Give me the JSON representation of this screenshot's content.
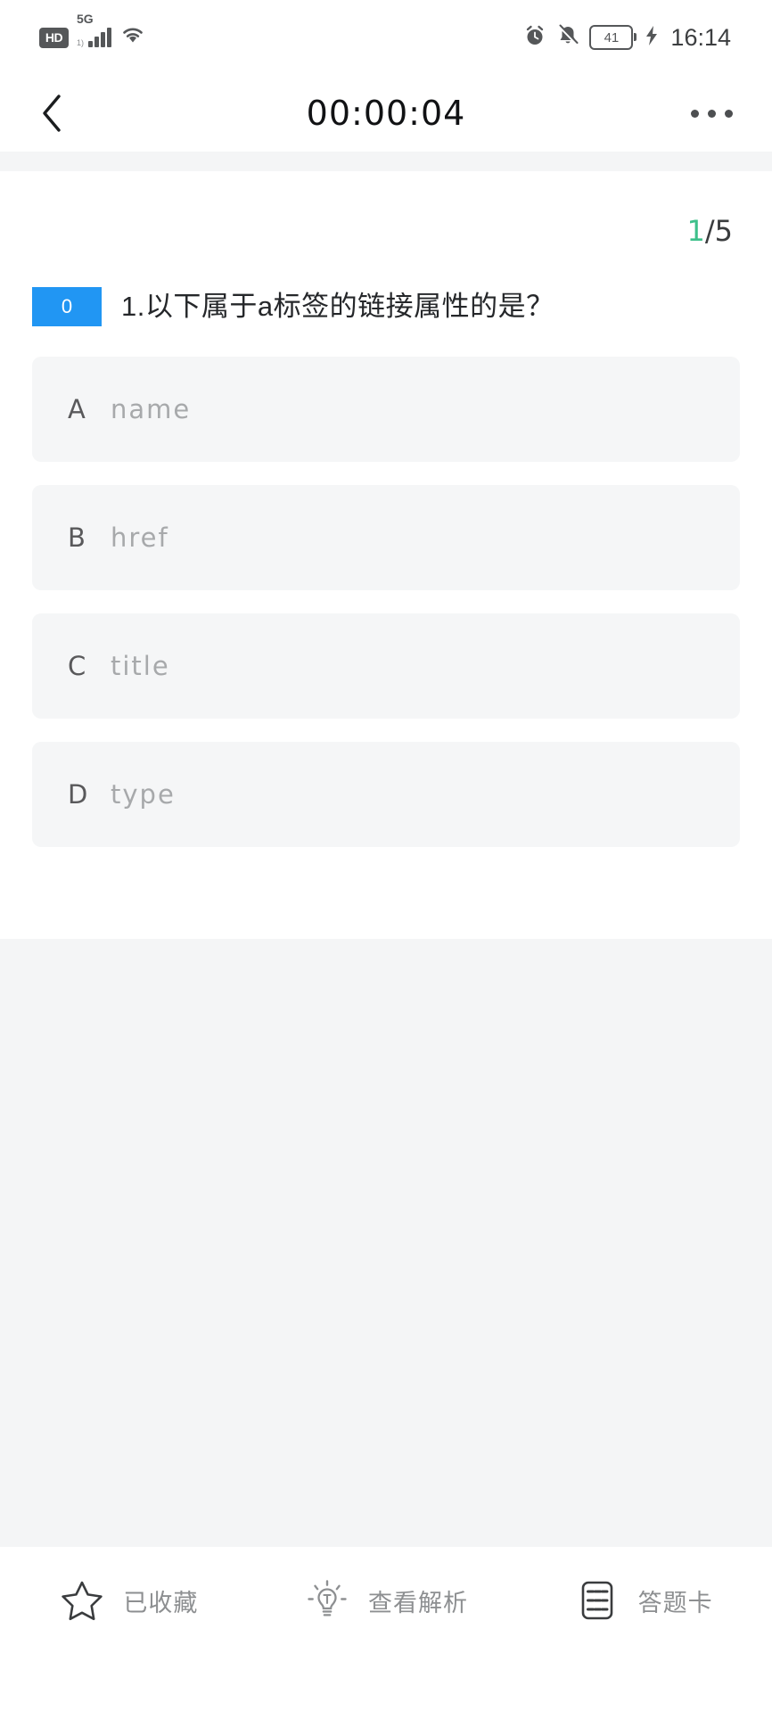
{
  "status_bar": {
    "hd_badge": "HD",
    "network_label": "5G",
    "network_sub": "1)",
    "battery_level": "41",
    "time": "16:14",
    "icons": {
      "hd": "hd-icon",
      "signal": "signal-bars-icon",
      "wifi": "wifi-icon",
      "alarm": "alarm-clock-icon",
      "mute": "bell-muted-icon",
      "battery": "battery-icon",
      "charging": "charging-bolt-icon"
    }
  },
  "header": {
    "back_icon": "back-chevron-icon",
    "timer": "00:00:04",
    "more_icon": "more-dots-icon"
  },
  "quiz": {
    "progress": {
      "current": "1",
      "total": "/5"
    },
    "question": {
      "type_badge": "0",
      "badge_color": "#2196f3",
      "text": "1.以下属于a标签的链接属性的是？"
    },
    "options": [
      {
        "letter": "A",
        "text": "name"
      },
      {
        "letter": "B",
        "text": "href"
      },
      {
        "letter": "C",
        "text": "title"
      },
      {
        "letter": "D",
        "text": "type"
      }
    ]
  },
  "bottom_bar": {
    "items": [
      {
        "label": "已收藏",
        "icon": "star-outline-icon"
      },
      {
        "label": "查看解析",
        "icon": "lightbulb-icon"
      },
      {
        "label": "答题卡",
        "icon": "answer-sheet-grid-icon"
      }
    ]
  },
  "colors": {
    "accent_green": "#3dc08a",
    "badge_blue": "#2196f3",
    "option_bg": "#f5f6f7",
    "page_bg": "#f4f5f6"
  }
}
